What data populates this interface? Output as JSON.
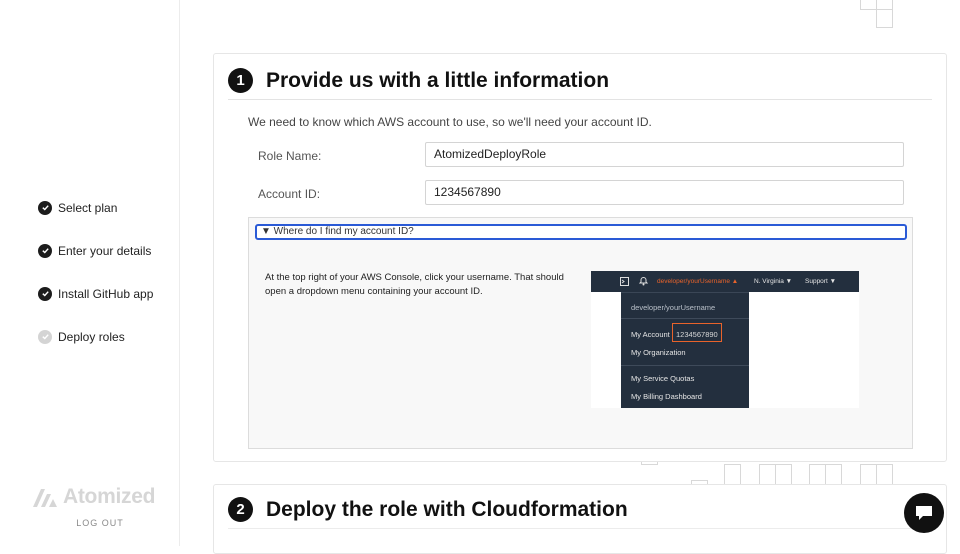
{
  "sidebar": {
    "steps": [
      {
        "label": "Select plan",
        "done": true
      },
      {
        "label": "Enter your details",
        "done": true
      },
      {
        "label": "Install GitHub app",
        "done": true
      },
      {
        "label": "Deploy roles",
        "done": false
      }
    ],
    "brand": "Atomized",
    "logout": "LOG OUT"
  },
  "step1": {
    "number": "1",
    "title": "Provide us with a little information",
    "intro": "We need to know which AWS account to use, so we'll need your account ID.",
    "role_label": "Role Name:",
    "role_value": "AtomizedDeployRole",
    "account_label": "Account ID:",
    "account_value": "1234567890",
    "details_summary": "▼ Where do I find my account ID?",
    "help_text": "At the top right of your AWS Console, click your username. That should open a dropdown menu containing your account ID.",
    "aws": {
      "username": "developer/yourUsername ▲",
      "region": "N. Virginia ▼",
      "support": "Support ▼",
      "menu_user": "developer/yourUsername",
      "my_account": "My Account",
      "account_id": "1234567890",
      "my_org": "My Organization",
      "quotas": "My Service Quotas",
      "billing": "My Billing Dashboard"
    }
  },
  "step2": {
    "number": "2",
    "title": "Deploy the role with Cloudformation"
  },
  "colors": {
    "aws_orange": "#e8632b",
    "aws_navy": "#232f3e",
    "focus_blue": "#2a5ad6"
  }
}
